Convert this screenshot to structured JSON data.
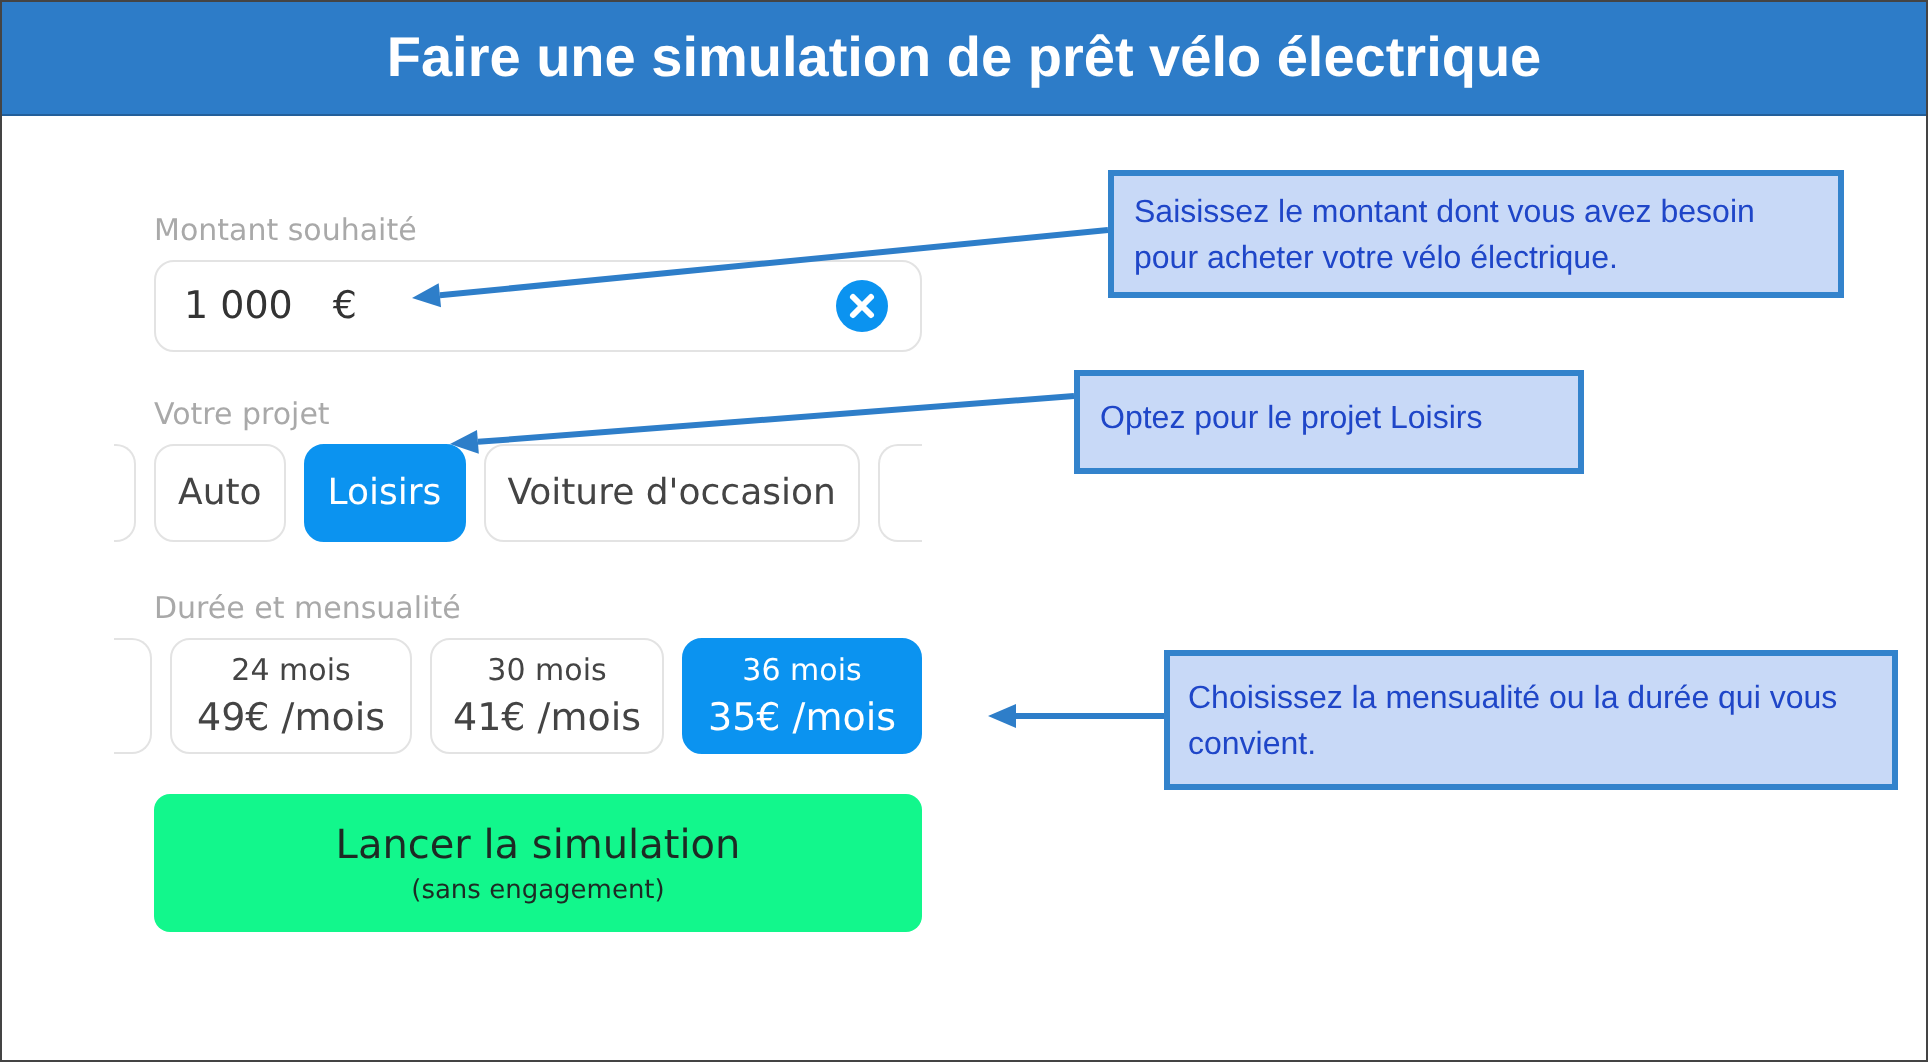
{
  "title": "Faire une simulation de prêt vélo électrique",
  "amount": {
    "label": "Montant souhaité",
    "value": "1 000",
    "currency": "€"
  },
  "project": {
    "label": "Votre projet",
    "options": [
      {
        "label": "Auto",
        "selected": false
      },
      {
        "label": "Loisirs",
        "selected": true
      },
      {
        "label": "Voiture d'occasion",
        "selected": false
      }
    ]
  },
  "duration": {
    "label": "Durée et mensualité",
    "options": [
      {
        "months": "24 mois",
        "payment": "49€ /mois",
        "selected": false
      },
      {
        "months": "30 mois",
        "payment": "41€ /mois",
        "selected": false
      },
      {
        "months": "36 mois",
        "payment": "35€ /mois",
        "selected": true
      }
    ]
  },
  "submit": {
    "label": "Lancer la simulation",
    "sublabel": "(sans engagement)"
  },
  "callouts": [
    {
      "text": "Saisissez le montant dont vous avez besoin pour acheter votre vélo électrique."
    },
    {
      "text": "Optez pour le projet Loisirs"
    },
    {
      "text": "Choisissez la mensualité ou la durée qui vous convient."
    }
  ]
}
